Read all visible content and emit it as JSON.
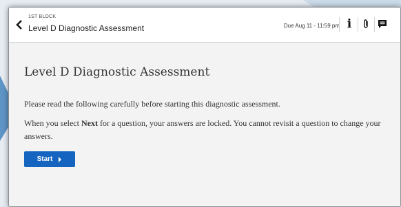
{
  "header": {
    "breadcrumb": "1ST BLOCK",
    "title": "Level D Diagnostic Assessment",
    "due": "Due Aug 11 - 11:59 pm",
    "icons": [
      "chevron-left-icon",
      "info-icon",
      "paperclip-icon",
      "chat-icon"
    ]
  },
  "main": {
    "heading": "Level D Diagnostic Assessment",
    "intro": "Please read the following carefully before starting this diagnostic assessment.",
    "note_before": "When you select ",
    "note_bold": "Next",
    "note_after": " for a question, your answers are locked. You cannot revisit a question to change your answers.",
    "start_label": "Start"
  },
  "colors": {
    "primary_button": "#1565c0",
    "content_bg": "#f3f3f3",
    "outer_bg": "#dfe7ef"
  }
}
